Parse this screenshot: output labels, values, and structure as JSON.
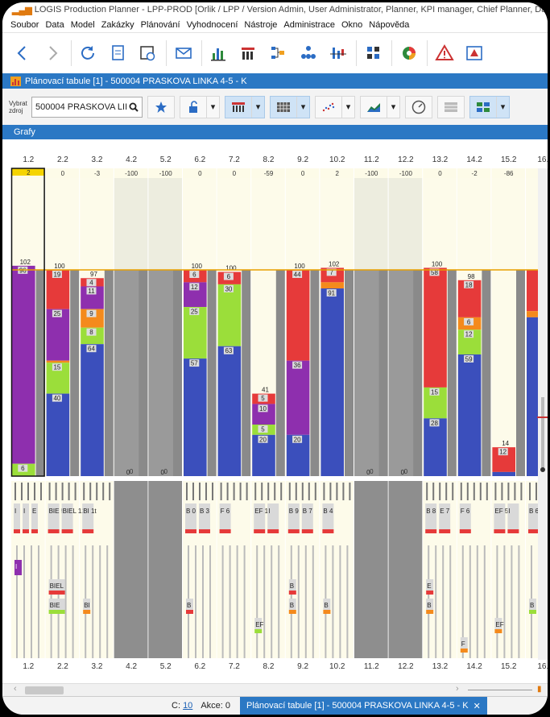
{
  "window_title": "LOGIS Production Planner - LPP-PROD [Orlik / LPP / Version Admin, User Administrator, Planner, KPI manager, Chief Planner, Data Loader]",
  "menu": [
    "Soubor",
    "Data",
    "Model",
    "Zakázky",
    "Plánování",
    "Vyhodnocení",
    "Nástroje",
    "Administrace",
    "Okno",
    "Nápověda"
  ],
  "toolbar_icons": [
    "back-arrow-icon",
    "forward-arrow-icon",
    "refresh-icon",
    "document-list-icon",
    "calendar-clock-icon",
    "envelope-icon",
    "bar-chart-icon",
    "stacked-chart-icon",
    "flow-chart-icon",
    "hierarchy-icon",
    "balance-chart-icon",
    "grid-split-icon",
    "pie-chart-icon",
    "warning-icon",
    "warning-box-icon"
  ],
  "doc_tab": "Plánovací tabule [1] - 500004 PRASKOVA LINKA 4-5 - K",
  "filter": {
    "label": "Vybrat zdroj",
    "source_value": "500004 PRASKOVA LII"
  },
  "grafy_label": "Grafy",
  "days": [
    "1.2",
    "2.2",
    "3.2",
    "4.2",
    "5.2",
    "6.2",
    "7.2",
    "8.2",
    "9.2",
    "10.2",
    "11.2",
    "12.2",
    "13.2",
    "14.2",
    "15.2",
    "16."
  ],
  "diffs": [
    "2",
    "0",
    "-3",
    "-100",
    "-100",
    "0",
    "0",
    "-59",
    "0",
    "2",
    "-100",
    "-100",
    "0",
    "-2",
    "-86",
    ""
  ],
  "totals": [
    "102",
    "100",
    "97",
    "0",
    "0",
    "100",
    "100",
    "41",
    "100",
    "102",
    "0",
    "0",
    "100",
    "98",
    "14",
    ""
  ],
  "bars": [
    [
      {
        "c": "purple",
        "v": 96,
        "l": "96"
      },
      {
        "c": "green",
        "v": 6,
        "l": "6"
      }
    ],
    [
      {
        "c": "red",
        "v": 19,
        "l": "19"
      },
      {
        "c": "purple",
        "v": 25,
        "l": "25"
      },
      {
        "c": "orange",
        "v": 1,
        "l": ""
      },
      {
        "c": "green",
        "v": 15,
        "l": "15"
      },
      {
        "c": "blue",
        "v": 40,
        "l": "40"
      }
    ],
    [
      {
        "c": "red",
        "v": 4,
        "l": "4"
      },
      {
        "c": "purple",
        "v": 11,
        "l": "11"
      },
      {
        "c": "orange",
        "v": 9,
        "l": "9"
      },
      {
        "c": "green",
        "v": 8,
        "l": "8"
      },
      {
        "c": "blue",
        "v": 64,
        "l": "64"
      }
    ],
    [],
    [],
    [
      {
        "c": "red",
        "v": 6,
        "l": "6"
      },
      {
        "c": "purple",
        "v": 12,
        "l": "12"
      },
      {
        "c": "green",
        "v": 25,
        "l": "25"
      },
      {
        "c": "blue",
        "v": 57,
        "l": "57"
      }
    ],
    [
      {
        "c": "red",
        "v": 6,
        "l": "6"
      },
      {
        "c": "green",
        "v": 30,
        "l": "30"
      },
      {
        "c": "blue",
        "v": 63,
        "l": "63"
      }
    ],
    [
      {
        "c": "red",
        "v": 5,
        "l": "5"
      },
      {
        "c": "purple",
        "v": 10,
        "l": "10"
      },
      {
        "c": "green",
        "v": 5,
        "l": "5"
      },
      {
        "c": "blue",
        "v": 20,
        "l": "20"
      }
    ],
    [
      {
        "c": "red",
        "v": 44,
        "l": "44"
      },
      {
        "c": "purple",
        "v": 36,
        "l": "36"
      },
      {
        "c": "blue",
        "v": 20,
        "l": "20"
      }
    ],
    [
      {
        "c": "red",
        "v": 7,
        "l": "7"
      },
      {
        "c": "orange",
        "v": 3,
        "l": ""
      },
      {
        "c": "blue",
        "v": 91,
        "l": "91"
      }
    ],
    [],
    [],
    [
      {
        "c": "red",
        "v": 58,
        "l": "58"
      },
      {
        "c": "green",
        "v": 15,
        "l": "15"
      },
      {
        "c": "blue",
        "v": 28,
        "l": "28"
      }
    ],
    [
      {
        "c": "red",
        "v": 18,
        "l": "18"
      },
      {
        "c": "orange",
        "v": 6,
        "l": "6"
      },
      {
        "c": "green",
        "v": 12,
        "l": "12"
      },
      {
        "c": "blue",
        "v": 59,
        "l": "59"
      }
    ],
    [
      {
        "c": "red",
        "v": 12,
        "l": "12"
      },
      {
        "c": "blue",
        "v": 2,
        "l": ""
      }
    ],
    [
      {
        "c": "red",
        "v": 20,
        "l": ""
      },
      {
        "c": "orange",
        "v": 3,
        "l": ""
      },
      {
        "c": "blue",
        "v": 77,
        "l": ""
      }
    ]
  ],
  "lane_labels": {
    "row1": [
      [
        "I",
        "I",
        "E"
      ],
      [
        "BIE 56t",
        "BIEL 12 7"
      ],
      [
        "BI 1t"
      ],
      [],
      [],
      [
        "B 0",
        "B 3"
      ],
      [
        "F 6"
      ],
      [
        "EF 13",
        "I"
      ],
      [
        "B 9",
        "B 7"
      ],
      [
        "B 4"
      ],
      [],
      [],
      [
        "B 8",
        "E 7"
      ],
      [
        "F 6"
      ],
      [
        "EF 58",
        "I"
      ],
      [
        "B 6"
      ]
    ],
    "gantt": [
      {
        "d": 0,
        "lane": 0,
        "t": "I",
        "c": "purple"
      },
      {
        "d": 1,
        "lane": 1,
        "t": "BIEL",
        "c": "red"
      },
      {
        "d": 1,
        "lane": 2,
        "t": "BIE",
        "c": "green"
      },
      {
        "d": 2,
        "lane": 2,
        "t": "BI",
        "c": "orange"
      },
      {
        "d": 5,
        "lane": 2,
        "t": "B",
        "c": "red"
      },
      {
        "d": 7,
        "lane": 3,
        "t": "EF",
        "c": "green"
      },
      {
        "d": 8,
        "lane": 1,
        "t": "B",
        "c": "red"
      },
      {
        "d": 8,
        "lane": 2,
        "t": "B",
        "c": "orange"
      },
      {
        "d": 9,
        "lane": 2,
        "t": "B",
        "c": "orange"
      },
      {
        "d": 12,
        "lane": 1,
        "t": "E",
        "c": "red"
      },
      {
        "d": 12,
        "lane": 2,
        "t": "B",
        "c": "orange"
      },
      {
        "d": 13,
        "lane": 4,
        "t": "F",
        "c": "orange"
      },
      {
        "d": 14,
        "lane": 3,
        "t": "EF",
        "c": "orange"
      },
      {
        "d": 15,
        "lane": 2,
        "t": "B",
        "c": "green"
      }
    ]
  },
  "colors": {
    "red": "#e63a3a",
    "purple": "#8e2fae",
    "orange": "#f48a1c",
    "green": "#9bde3a",
    "blue": "#3b4fbc",
    "gray": "#8a8a8a",
    "cream": "#fdfbea",
    "accent": "#2b78c4"
  },
  "status": {
    "c_label": "C:",
    "c_value": "10",
    "akce": "Akce: 0",
    "tab": "Plánovací tabule [1] - 500004 PRASKOVA LINKA 4-5 - K"
  }
}
